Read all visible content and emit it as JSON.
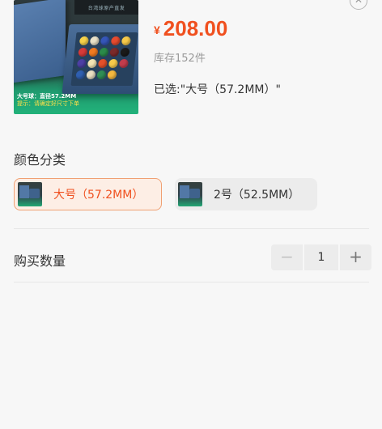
{
  "product": {
    "price_currency": "¥",
    "price_amount": "208.00",
    "stock": "库存152件",
    "selected": "已选:\"大号（57.2MM）\"",
    "image": {
      "banner_text": "台湾球原产直发",
      "caption_line1": "大号球：直径57.2MM",
      "caption_line2": "提示：请确定好尺寸下单"
    }
  },
  "close_icon": "close-circle-icon",
  "color_section": {
    "title": "颜色分类",
    "options": [
      {
        "label": "大号（57.2MM）",
        "selected": true
      },
      {
        "label": "2号（52.5MM）",
        "selected": false
      }
    ]
  },
  "quantity_section": {
    "title": "购买数量",
    "minus": "−",
    "value": "1",
    "plus": "+"
  },
  "colors": {
    "accent": "#f0501f",
    "selected_bg": "#fdeee5",
    "selected_border": "#f0a073",
    "chip_bg": "#ececec"
  }
}
